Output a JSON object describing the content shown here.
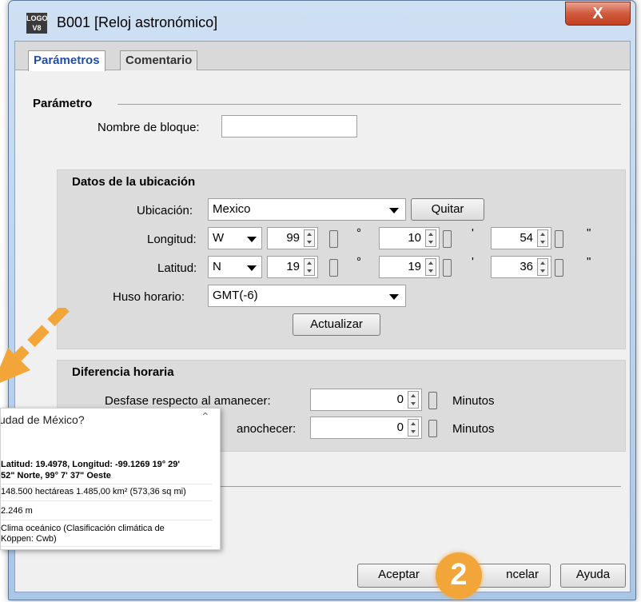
{
  "window": {
    "app_icon_text": "LOGO V8",
    "title": "B001 [Reloj astronómico]",
    "close_glyph": "X"
  },
  "tabs": [
    {
      "label": "Parámetros",
      "active": true
    },
    {
      "label": "Comentario",
      "active": false
    }
  ],
  "parametro": {
    "heading": "Parámetro",
    "block_name_label": "Nombre de bloque:",
    "block_name_value": ""
  },
  "ubicacion": {
    "heading": "Datos de la ubicación",
    "location_label": "Ubicación:",
    "location_value": "Mexico",
    "remove_button": "Quitar",
    "longitude": {
      "label": "Longitud:",
      "dir": "W",
      "deg": "99",
      "min": "10",
      "sec": "54"
    },
    "latitude": {
      "label": "Latitud:",
      "dir": "N",
      "deg": "19",
      "min": "19",
      "sec": "36"
    },
    "deg_symbol": "°",
    "min_symbol": "'",
    "sec_symbol": "\"",
    "timezone_label": "Huso horario:",
    "timezone_value": "GMT(-6)",
    "update_button": "Actualizar"
  },
  "diferencia": {
    "heading": "Diferencia horaria",
    "sunrise_label": "Desfase respecto al amanecer:",
    "sunrise_value": "0",
    "sunrise_unit": "Minutos",
    "sunset_label": "anochecer:",
    "sunset_value": "0",
    "sunset_unit": "Minutos"
  },
  "tooltip": {
    "title": "udad de México?",
    "line1": "Latitud: 19.4978, Longitud: -99.1269 19° 29'",
    "line2": "52\" Norte, 99° 7' 37\" Oeste",
    "line3": "148.500 hectáreas 1.485,00 km² (573,36 sq mi)",
    "line4": "2.246 m",
    "line5": "Clima oceánico (Clasificación climática de",
    "line6": "Köppen: Cwb)"
  },
  "footer": {
    "ok_button": "Aceptar",
    "cancel_button": "ncelar",
    "help_button": "Ayuda"
  },
  "badge": {
    "number": "2"
  },
  "colors": {
    "accent_arrow": "#f2a63a",
    "close_red": "#c8452a",
    "active_tab_text": "#1f4fa8"
  }
}
